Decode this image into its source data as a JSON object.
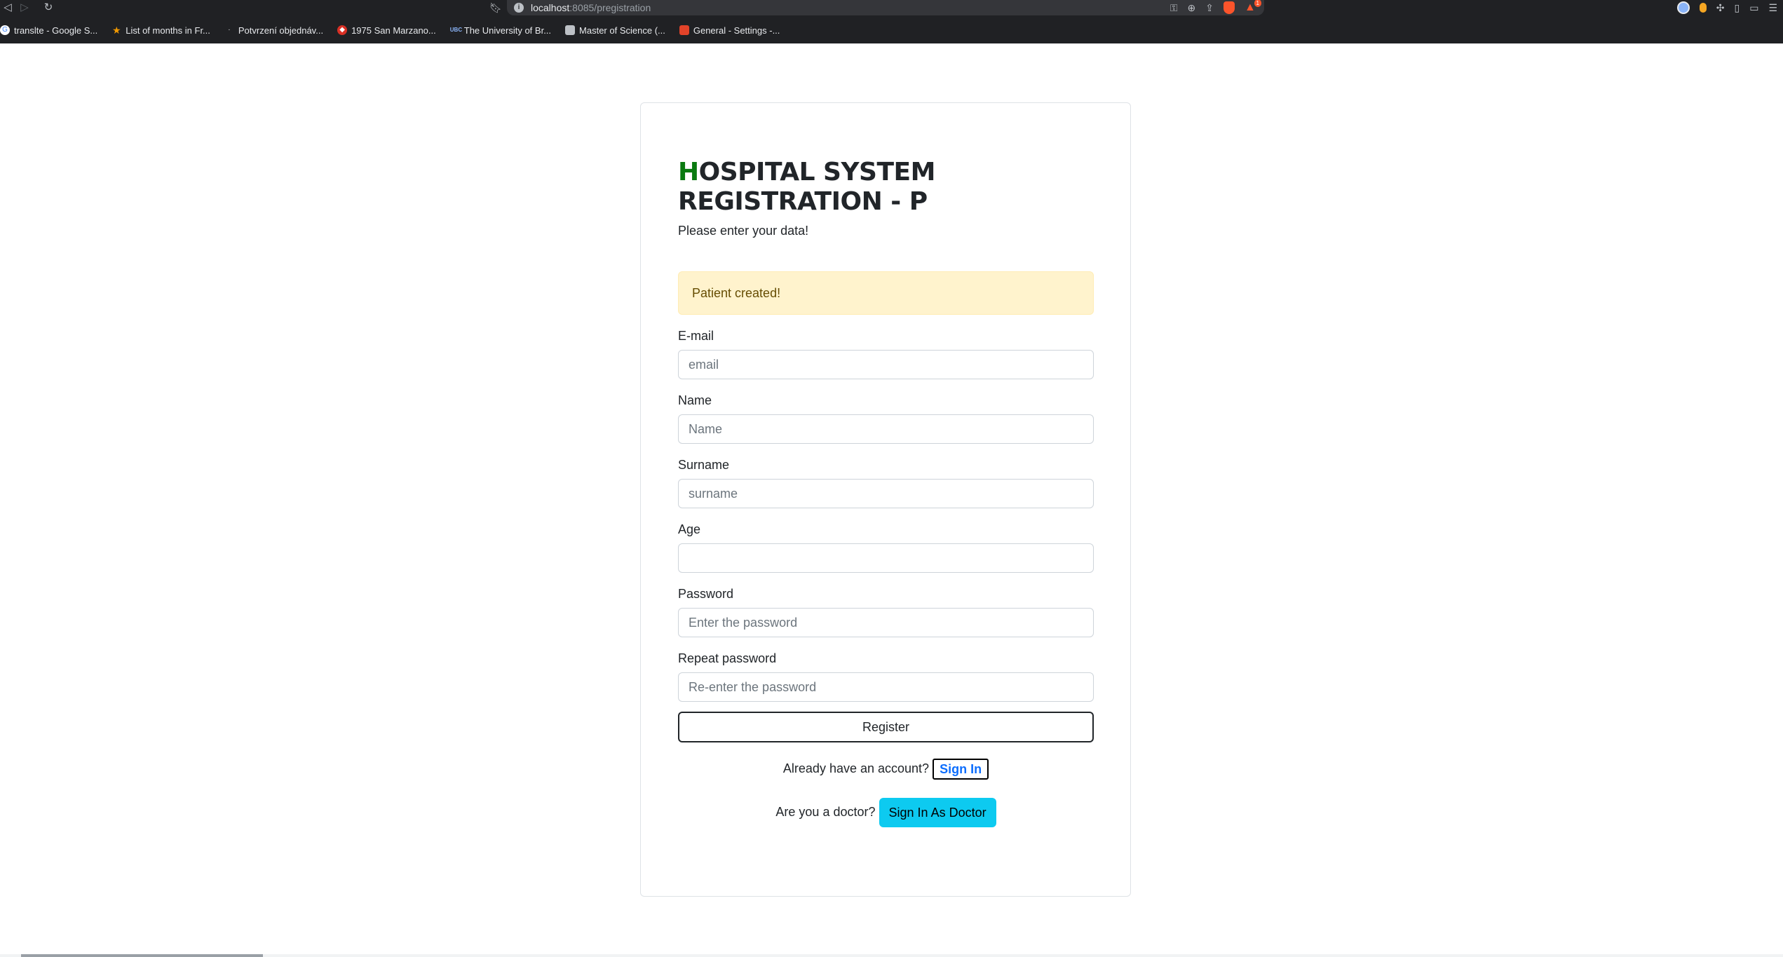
{
  "browser": {
    "url_host": "localhost",
    "url_rest": ":8085/pregistration",
    "alert_count": "1",
    "bookmarks": [
      {
        "label": "translte - Google S..."
      },
      {
        "label": "List of months in Fr..."
      },
      {
        "label": "Potvrzení objednáv..."
      },
      {
        "label": "1975 San Marzano..."
      },
      {
        "label": "The University of Br..."
      },
      {
        "label": "Master of Science (..."
      },
      {
        "label": "General - Settings -..."
      }
    ]
  },
  "page": {
    "title_first": "H",
    "title_rest": "OSPITAL SYSTEM REGISTRATION - P",
    "subtitle": "Please enter your data!",
    "alert": "Patient created!",
    "fields": {
      "email": {
        "label": "E-mail",
        "placeholder": "email"
      },
      "name": {
        "label": "Name",
        "placeholder": "Name"
      },
      "surname": {
        "label": "Surname",
        "placeholder": "surname"
      },
      "age": {
        "label": "Age",
        "placeholder": ""
      },
      "password": {
        "label": "Password",
        "placeholder": "Enter the password"
      },
      "repeat_password": {
        "label": "Repeat password",
        "placeholder": "Re-enter the password"
      }
    },
    "register_label": "Register",
    "account_prompt": "Already have an account?",
    "sign_in_label": "Sign In",
    "doctor_prompt": "Are you a doctor?",
    "doctor_sign_in_label": "Sign In As Doctor"
  }
}
